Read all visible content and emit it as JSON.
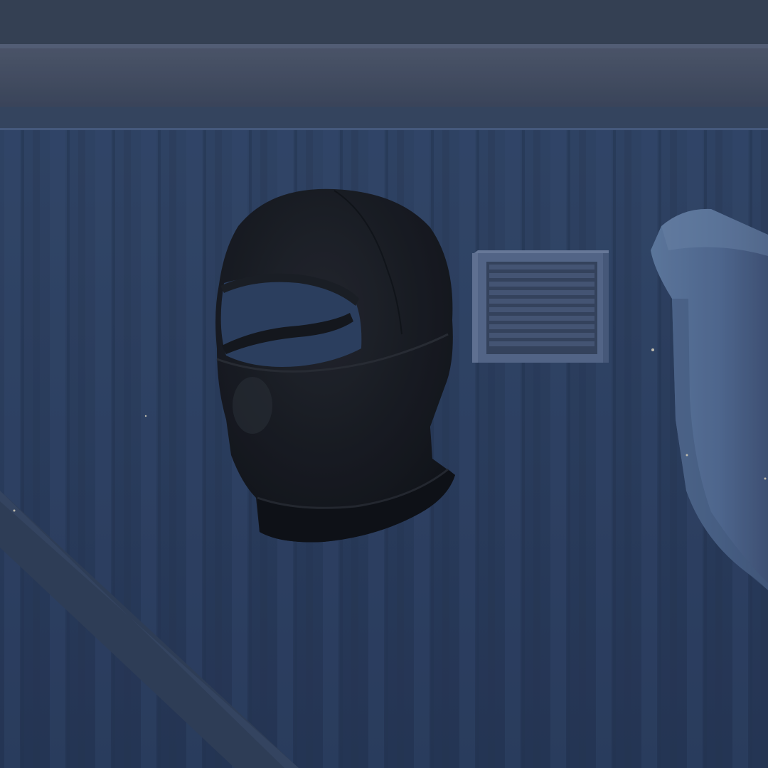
{
  "scene": {
    "subject": "balaclava-item",
    "colors": {
      "wall_base": "#2f4466",
      "wall_rib_light": "#3a5178",
      "wall_rib_dark": "#263855",
      "beam": "#47536a",
      "beam_top": "#3b465b",
      "balaclava": "#16181d",
      "balaclava_highlight": "#2a2d34",
      "vent_frame": "#5c6f93",
      "vent_slat": "#3a4863",
      "pipe": "#5f7aa0",
      "pipe_shadow": "#4a6288",
      "brace": "#33425d"
    },
    "props": {
      "item": "balaclava-icon",
      "vent": "wall-vent-icon",
      "pipe": "duct-pipe-icon",
      "brace": "diagonal-brace-icon",
      "beam": "ceiling-beam-icon"
    }
  }
}
